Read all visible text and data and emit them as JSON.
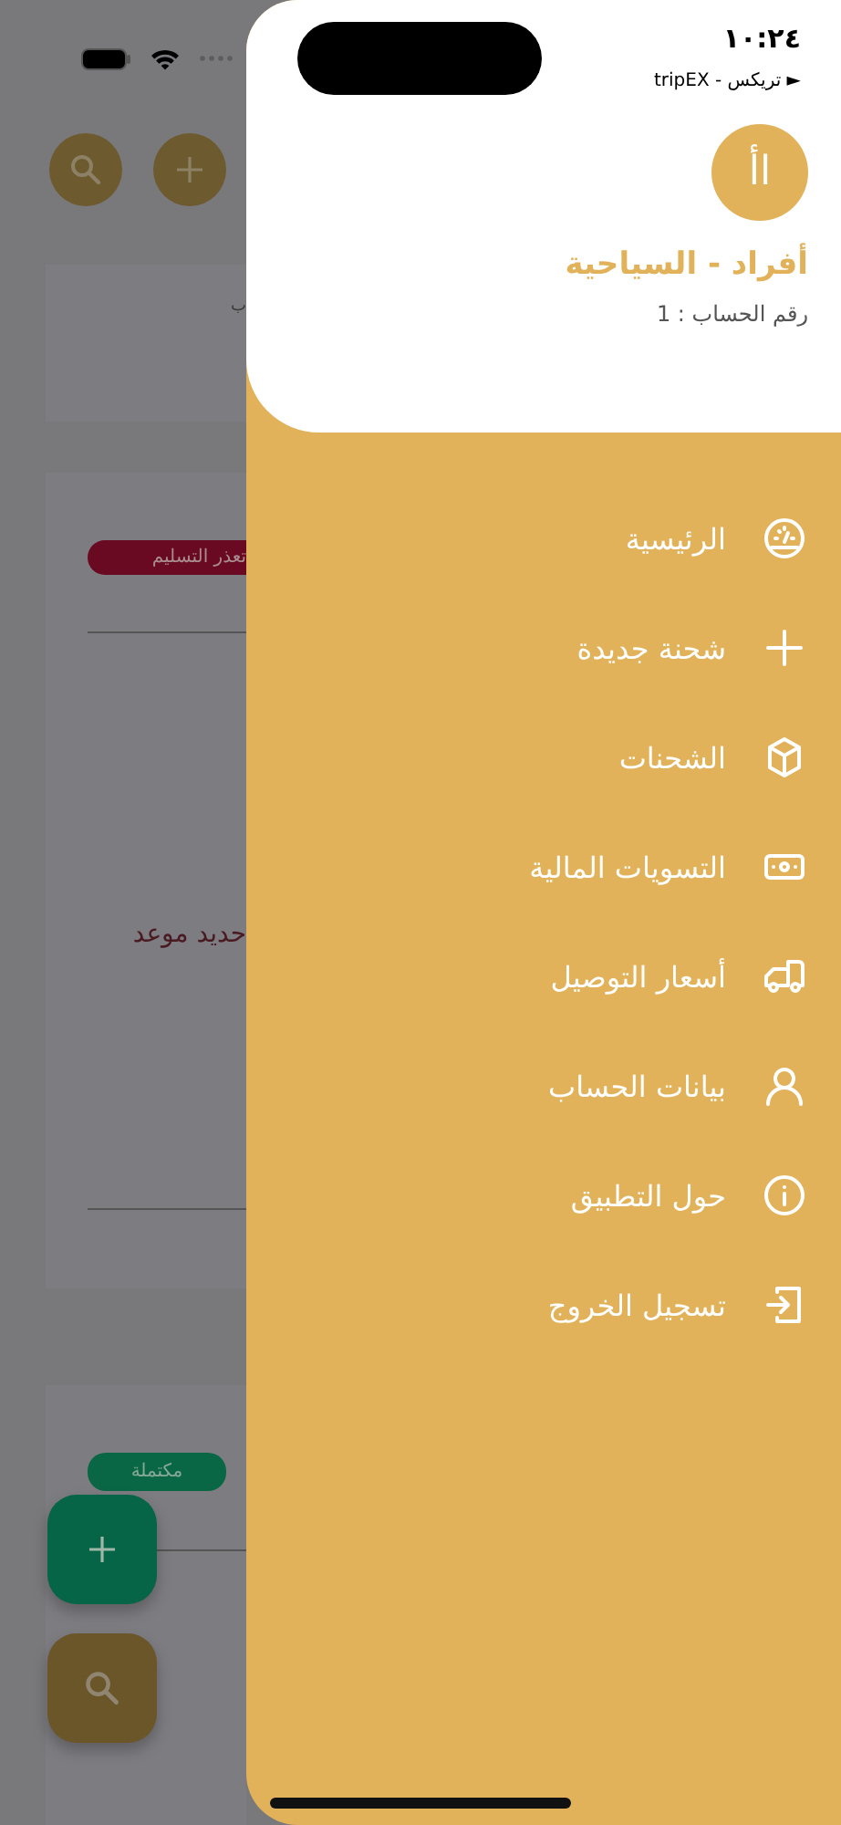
{
  "background_page": {
    "card_1": {
      "fragment": "ب"
    },
    "card_2": {
      "badge": "تعذر التسليم",
      "text": "حديد موعد"
    },
    "card_3": {
      "badge": "مكتملة"
    }
  },
  "status_bar": {
    "time": "١٠:٢٤",
    "back_link": "► تريكس - tripEX"
  },
  "drawer": {
    "avatar": "اأ",
    "account_name": "أفراد - السياحية",
    "account_number": "رقم الحساب : 1",
    "items": [
      {
        "label": "الرئيسية",
        "kind": "dashboard"
      },
      {
        "label": "شحنة جديدة",
        "kind": "plus"
      },
      {
        "label": "الشحنات",
        "kind": "box"
      },
      {
        "label": "التسويات المالية",
        "kind": "money"
      },
      {
        "label": "أسعار التوصيل",
        "kind": "truck"
      },
      {
        "label": "بيانات الحساب",
        "kind": "user"
      },
      {
        "label": "حول التطبيق",
        "kind": "info"
      },
      {
        "label": "تسجيل الخروج",
        "kind": "logout"
      }
    ]
  }
}
